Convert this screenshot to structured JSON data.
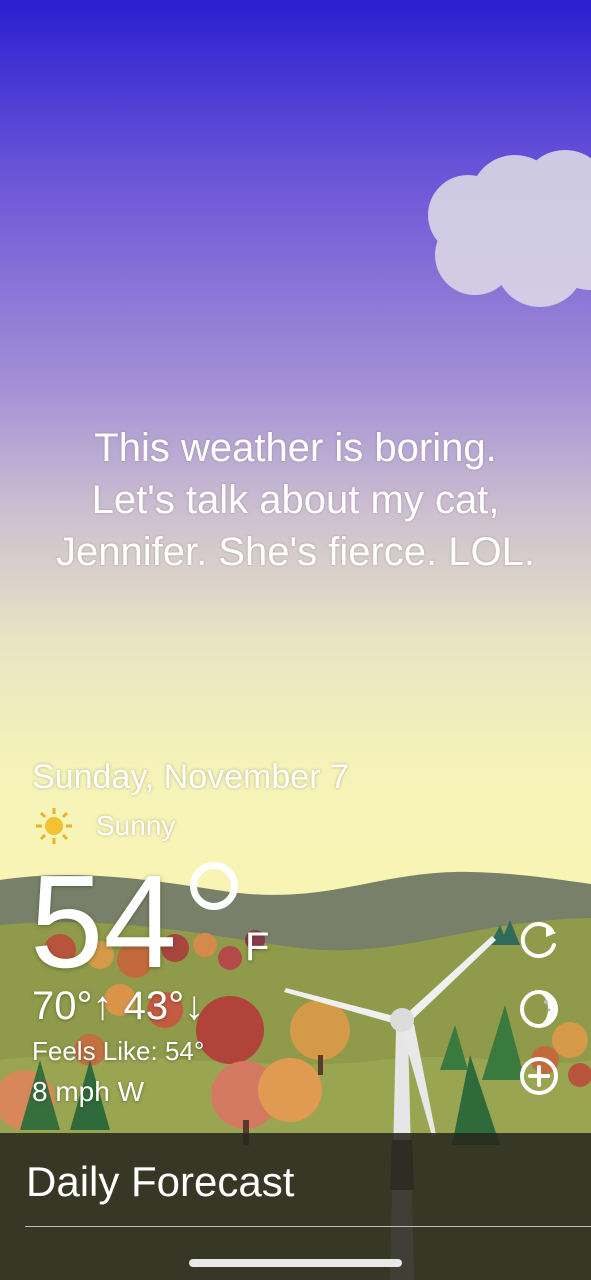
{
  "message": {
    "line1": "This weather is boring.",
    "line2": "Let's talk about my cat,",
    "line3": "Jennifer. She's fierce. LOL."
  },
  "weather": {
    "date": "Sunday, November 7",
    "condition": "Sunny",
    "condition_icon": "sun-icon",
    "temperature": "54",
    "unit": "F",
    "high": "70°",
    "low": "43°",
    "high_icon": "arrow-up-icon",
    "low_icon": "arrow-down-icon",
    "feels_like": "Feels Like: 54°",
    "wind": "8 mph W"
  },
  "actions": [
    {
      "icon": "refresh-icon"
    },
    {
      "icon": "moon-phase-icon"
    },
    {
      "icon": "add-location-icon"
    }
  ],
  "forecast": {
    "title": "Daily Forecast"
  },
  "colors": {
    "sky_top": "#2a1fd0",
    "sky_mid": "#a48fd6",
    "sky_bottom": "#f8f5b4",
    "hill_far": "#7b8466",
    "hill_near": "#8e9a48",
    "forecast_bar": "#28281e"
  }
}
